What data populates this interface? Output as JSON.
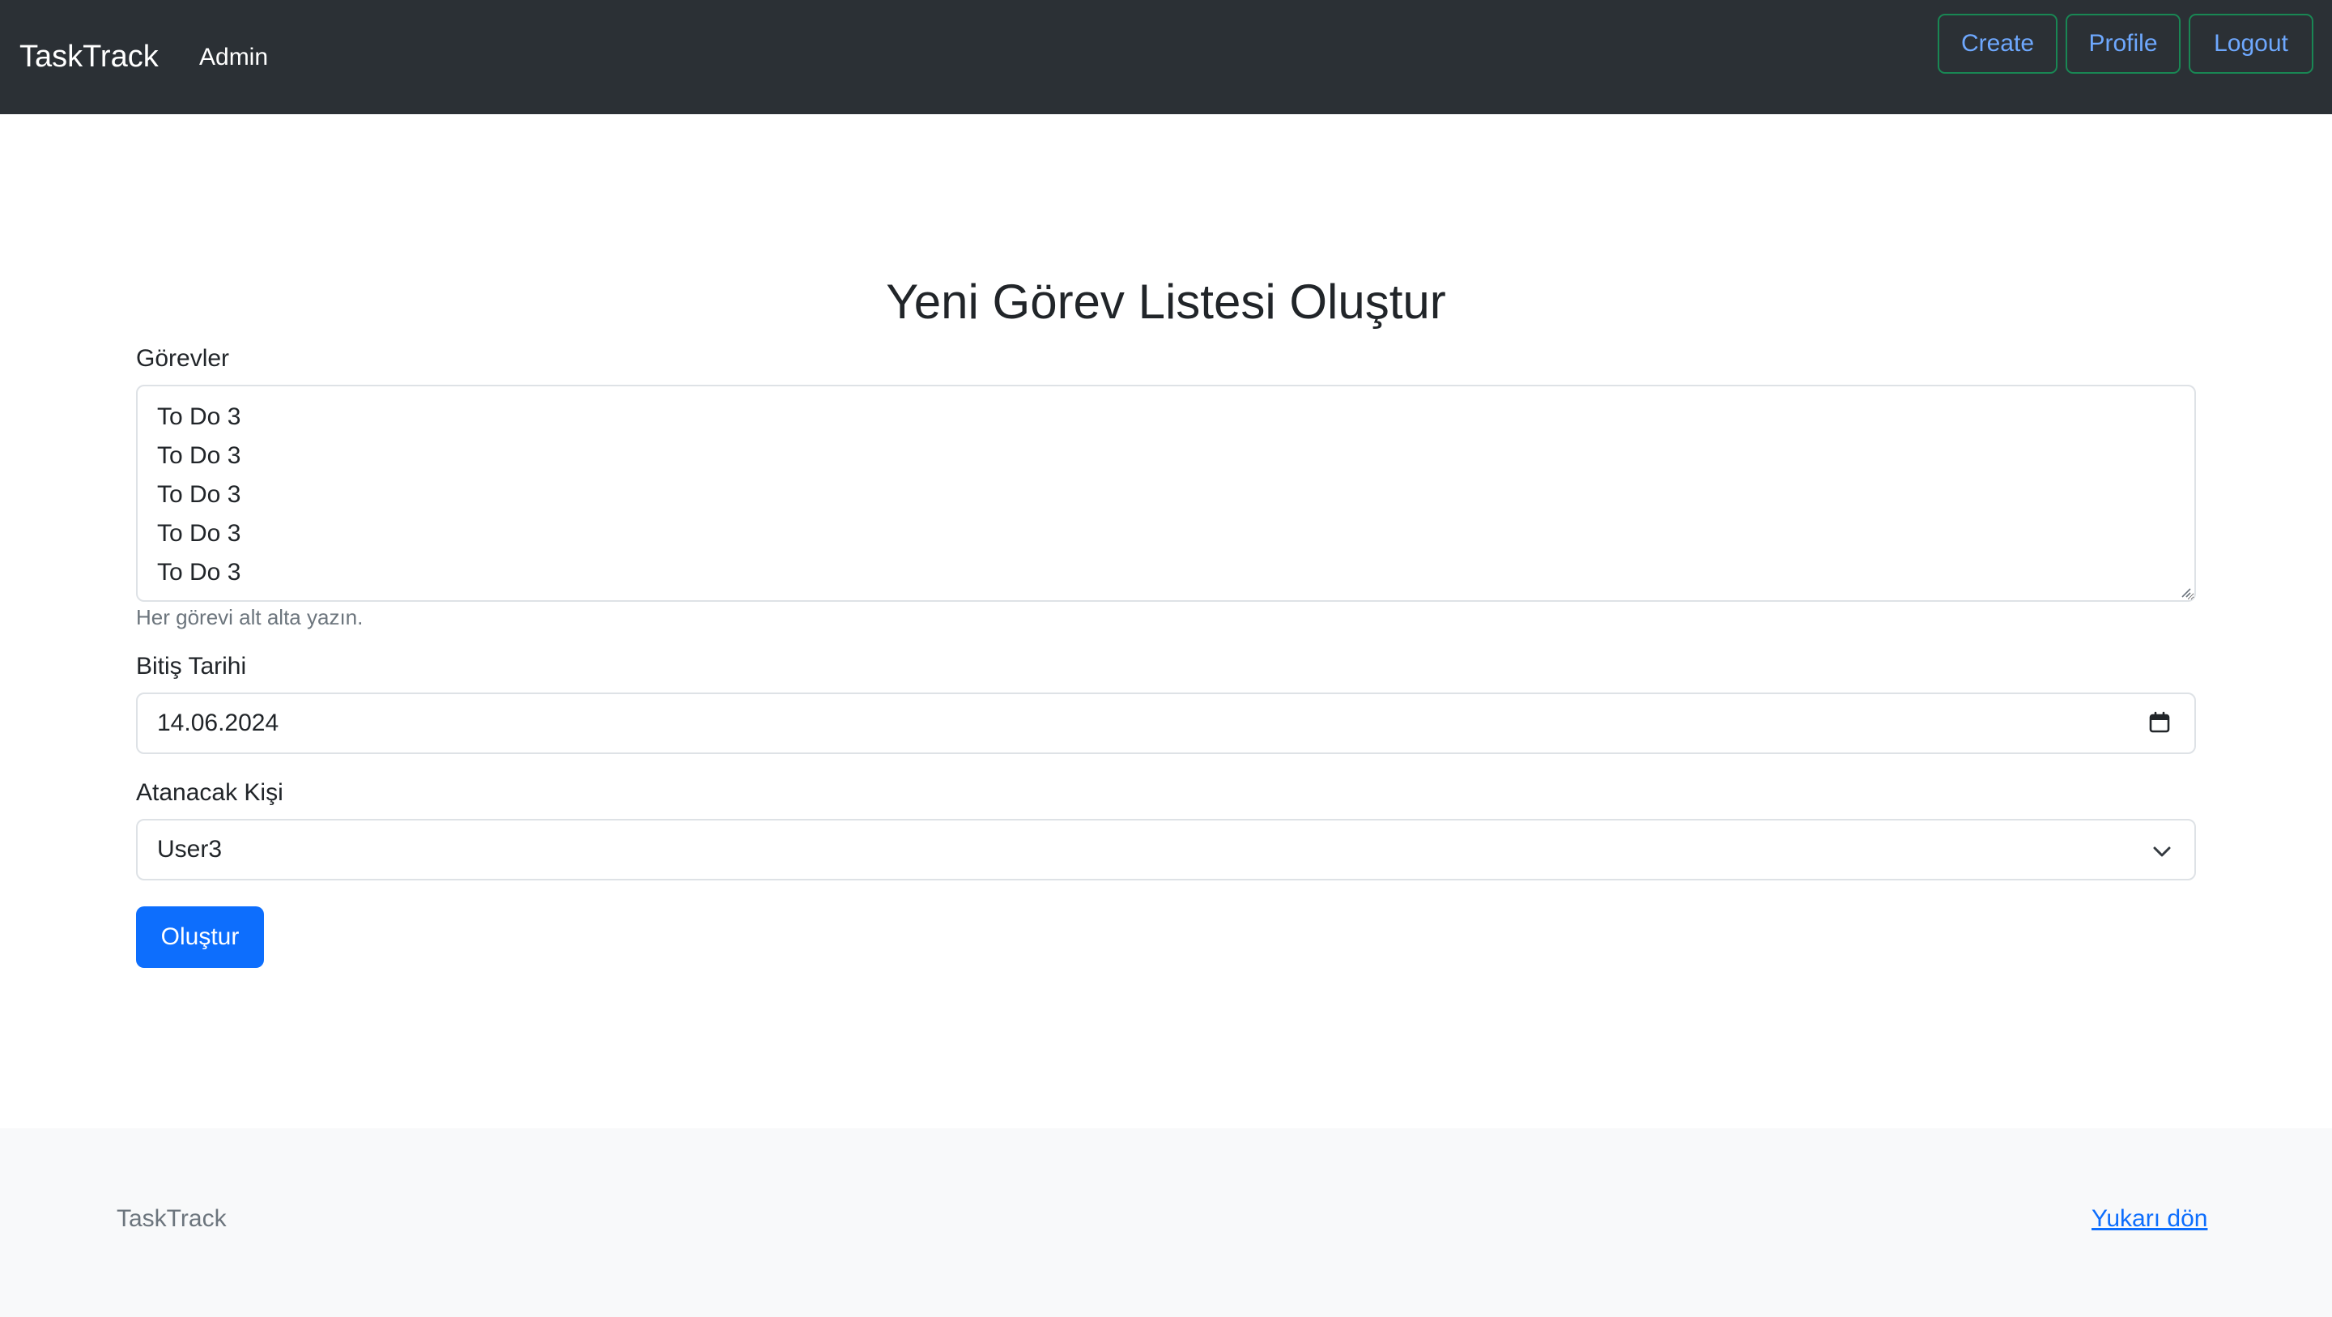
{
  "navbar": {
    "brand": "TaskTrack",
    "user": "Admin",
    "buttons": {
      "create": "Create",
      "profile": "Profile",
      "logout": "Logout"
    },
    "background": "#2b3035",
    "button_border": "#198754",
    "button_text": "#6ea8fe"
  },
  "form": {
    "title": "Yeni Görev Listesi Oluştur",
    "tasks": {
      "label": "Görevler",
      "value": "To Do 3\nTo Do 3\nTo Do 3\nTo Do 3\nTo Do 3",
      "help": "Her görevi alt alta yazın."
    },
    "due_date": {
      "label": "Bitiş Tarihi",
      "value": "14.06.2024",
      "icon": "calendar-icon"
    },
    "assignee": {
      "label": "Atanacak Kişi",
      "selected": "User3",
      "icon": "chevron-down-icon"
    },
    "submit_label": "Oluştur",
    "accent": "#0d6efd"
  },
  "footer": {
    "brand": "TaskTrack",
    "back_to_top": "Yukarı dön"
  }
}
